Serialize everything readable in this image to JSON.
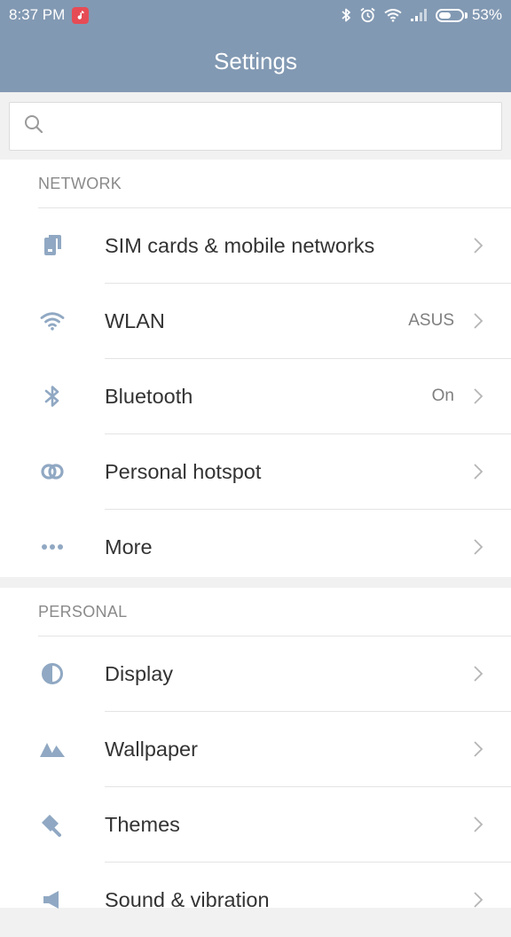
{
  "status_bar": {
    "time": "8:37 PM",
    "battery": "53%",
    "battery_level": 0.53,
    "icons": [
      "music-notification-icon",
      "bluetooth-icon",
      "alarm-icon",
      "wifi-icon",
      "signal-icon",
      "battery-icon"
    ]
  },
  "header": {
    "title": "Settings"
  },
  "search": {
    "placeholder": "",
    "value": ""
  },
  "sections": {
    "network": {
      "title": "NETWORK",
      "items": [
        {
          "label": "SIM cards & mobile networks",
          "value": "",
          "icon": "sim-card-icon"
        },
        {
          "label": "WLAN",
          "value": "ASUS",
          "icon": "wifi-icon"
        },
        {
          "label": "Bluetooth",
          "value": "On",
          "icon": "bluetooth-icon"
        },
        {
          "label": "Personal hotspot",
          "value": "",
          "icon": "hotspot-icon"
        },
        {
          "label": "More",
          "value": "",
          "icon": "more-dots-icon"
        }
      ]
    },
    "personal": {
      "title": "PERSONAL",
      "items": [
        {
          "label": "Display",
          "value": "",
          "icon": "display-icon"
        },
        {
          "label": "Wallpaper",
          "value": "",
          "icon": "wallpaper-icon"
        },
        {
          "label": "Themes",
          "value": "",
          "icon": "themes-icon"
        },
        {
          "label": "Sound & vibration",
          "value": "",
          "icon": "sound-icon"
        }
      ]
    }
  },
  "colors": {
    "accent": "#8299b3",
    "icon": "#90a8c3",
    "background": "#f1f1f1"
  }
}
